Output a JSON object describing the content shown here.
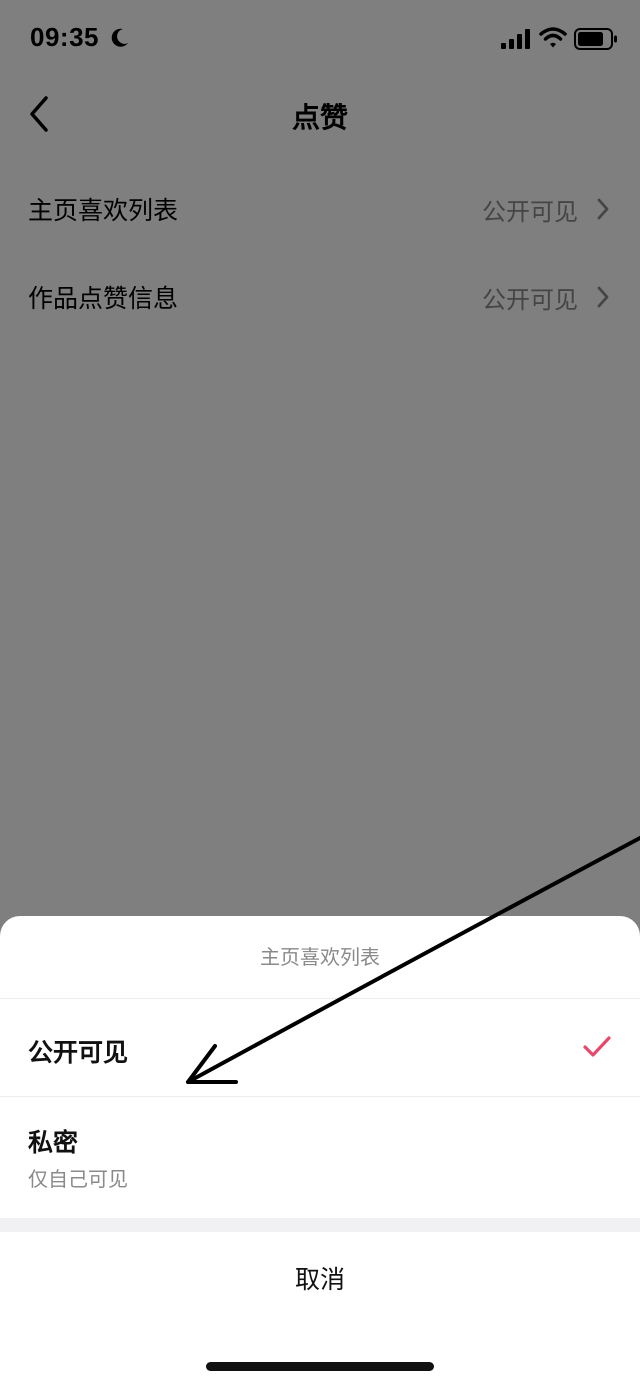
{
  "status_bar": {
    "time": "09:35",
    "icons": [
      "moon-icon",
      "signal-icon",
      "wifi-icon",
      "battery-icon"
    ]
  },
  "nav": {
    "title": "点赞",
    "back_icon": "back-icon"
  },
  "settings": {
    "rows": [
      {
        "label": "主页喜欢列表",
        "value": "公开可见"
      },
      {
        "label": "作品点赞信息",
        "value": "公开可见"
      }
    ]
  },
  "sheet": {
    "title": "主页喜欢列表",
    "options": [
      {
        "label": "公开可见",
        "selected": true
      },
      {
        "label": "私密",
        "subtitle": "仅自己可见",
        "selected": false
      }
    ],
    "cancel_label": "取消"
  },
  "colors": {
    "accent_check": "#e8496a",
    "overlay": "#7d7d7d",
    "secondary_text": "#8a8a8a"
  }
}
